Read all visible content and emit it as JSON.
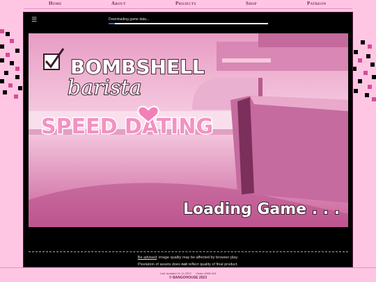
{
  "nav": {
    "home": "Home",
    "about": "About",
    "projects": "Projects",
    "shop": "Shop",
    "patreon": "Patreon"
  },
  "loader": {
    "status": "Downloading game data...",
    "progress": 0.04
  },
  "game": {
    "title_line1": "BOMBSHELL",
    "title_line2": "barista",
    "title_line3": "SPEED DATING",
    "loading": "Loading Game . . ."
  },
  "notice": {
    "link": "Be advised",
    "line1_rest": ": image quality may be affected by browser play.",
    "line2_a": "Pixelation of assets does ",
    "line2_b": "not",
    "line2_c": " reflect quality of final product."
  },
  "footer": {
    "updated": "Last Updated 11-11-2023",
    "visitors": "Visitor #965,418",
    "copyright": "© BANGOHOUSE 2023"
  },
  "colors": {
    "accent": "#d54c97",
    "nav_bg": "#ffc6e4",
    "progress": "#2e6de0"
  }
}
